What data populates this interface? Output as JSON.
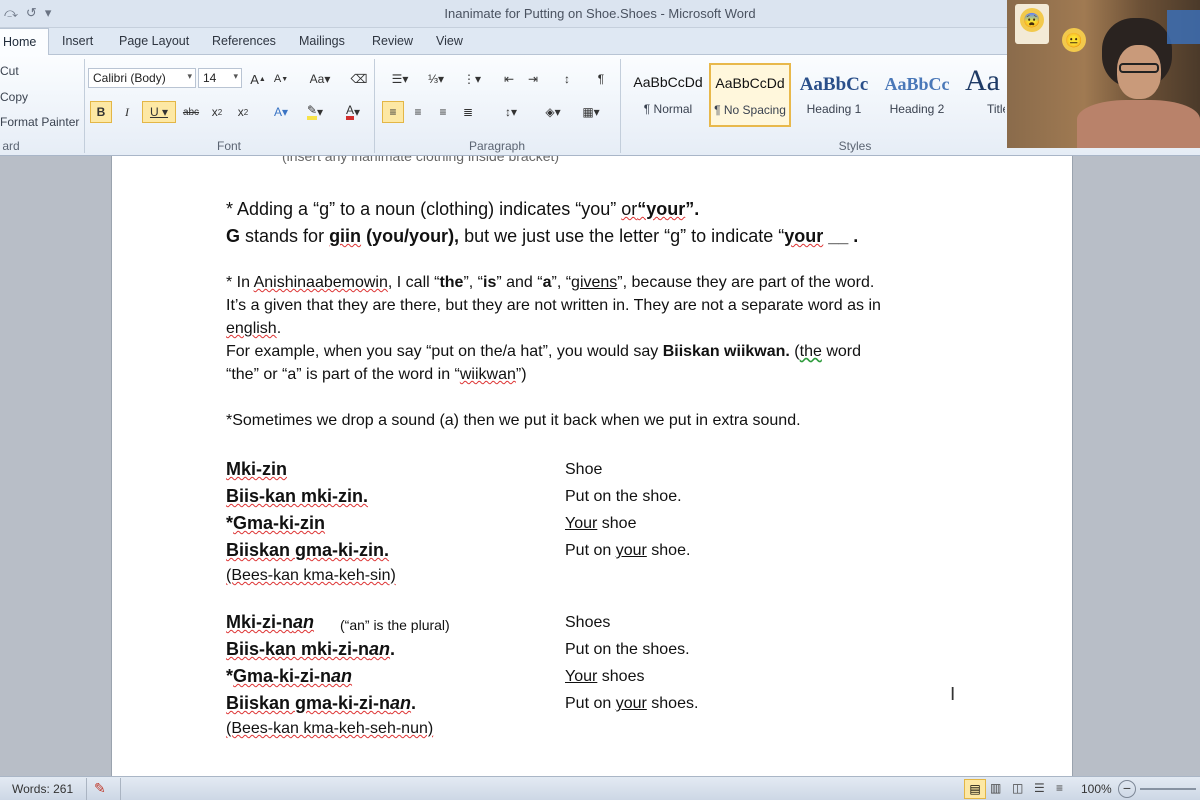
{
  "window": {
    "title": "Inanimate for Putting on Shoe.Shoes  -  Microsoft Word"
  },
  "tabs": [
    "Home",
    "Insert",
    "Page Layout",
    "References",
    "Mailings",
    "Review",
    "View"
  ],
  "clipboard": {
    "cut": "Cut",
    "copy": "Copy",
    "format_painter": "Format Painter",
    "group": "ard"
  },
  "font": {
    "name": "Calibri (Body)",
    "size": "14",
    "group": "Font"
  },
  "paragraph": {
    "group": "Paragraph"
  },
  "styles": {
    "group": "Styles",
    "items": [
      {
        "sample": "AaBbCcDd",
        "name": "¶ Normal"
      },
      {
        "sample": "AaBbCcDd",
        "name": "¶ No Spacing"
      },
      {
        "sample": "AaBbCc",
        "name": "Heading 1"
      },
      {
        "sample": "AaBbCc",
        "name": "Heading 2"
      },
      {
        "sample": "Aa",
        "name": "Title"
      }
    ]
  },
  "doc": {
    "top_cut": "(insert any inanimate clothing inside bracket)",
    "rule1a_pre": "* Adding a “g” to a noun (clothing) indicates “you” ",
    "rule1a_or": "or",
    "rule1a_your": "“your",
    "rule1a_end": "”.",
    "rule1b_g": "G",
    "rule1b_mid": " stands for ",
    "rule1b_giin": "giin",
    "rule1b_paren": " (you/your),",
    "rule1b_rest": "  but we just use the letter “g” to indicate “",
    "rule1b_your": "your",
    "rule1b_end": " __ .",
    "p2_l1_a": "* In ",
    "p2_l1_anish": "Anishinaabemowin",
    "p2_l1_b": ", I call “",
    "p2_l1_the": "the",
    "p2_l1_c": "”, “",
    "p2_l1_is": "is",
    "p2_l1_d": "” and “",
    "p2_l1_a2": "a",
    "p2_l1_e": "”, “",
    "p2_l1_givens": "givens",
    "p2_l1_f": "”, because they are part of the word.",
    "p2_l2": "It’s a given that they are there, but they are not written in.  They are not a separate word as in",
    "p2_l3": "english",
    "p2_l3_end": ".",
    "p2_l4_a": "For example, when you say “put on the/a hat”, you would say ",
    "p2_l4_b": "Biiskan wiikwan.",
    "p2_l4_c": "  (",
    "p2_l4_the": "the",
    "p2_l4_d": " word",
    "p2_l5_a": "“the” or “a” is part of the word in “",
    "p2_l5_w": "wiikwan",
    "p2_l5_b": "”)",
    "p3": "*Sometimes we drop a sound (a) then we put it back when we put in extra sound.",
    "s1_w1": "Mki-zin",
    "s1_e1": "Shoe",
    "s1_w2": "Biis-kan mki-zin.",
    "s1_e2": "Put on the shoe.",
    "s1_w3_star": "*",
    "s1_w3": "Gma-ki-zin",
    "s1_e3_u": "Your",
    "s1_e3_rest": " shoe",
    "s1_w4": "Biiskan gma-ki-zin.",
    "s1_e4_a": "Put on ",
    "s1_e4_u": "your",
    "s1_e4_b": " shoe.",
    "s1_pron": "(Bees-kan kma-keh-sin)",
    "s2_w1_a": "Mki-zi-n",
    "s2_w1_b": "an",
    "s2_note": "(“an” is the plural)",
    "s2_e1": "Shoes",
    "s2_w2_a": "Biis-kan mki-zi-n",
    "s2_w2_b": "an",
    "s2_w2_c": ".",
    "s2_e2": "Put on the shoes.",
    "s2_w3_star": "*",
    "s2_w3_a": "Gma-ki-zi-n",
    "s2_w3_b": "an",
    "s2_e3_u": "Your",
    "s2_e3_rest": " shoes",
    "s2_w4_a": "Biiskan gma-ki-zi-n",
    "s2_w4_b": "an",
    "s2_w4_c": ".",
    "s2_e4_a": "Put on ",
    "s2_e4_u": "your",
    "s2_e4_b": " shoes.",
    "s2_pron": "(Bees-kan kma-keh-seh-nun)"
  },
  "status": {
    "words": "Words: 261",
    "zoom": "100%"
  },
  "colors": {
    "accent": "#2b579a",
    "selected": "#fde8a4",
    "squiggle": "#d33333",
    "highlight": "#f7e34a",
    "fontcolor": "#d12d2d"
  },
  "icons": [
    "undo-icon",
    "save-icon",
    "bold-icon",
    "italic-icon",
    "underline-icon",
    "zoom-out-icon",
    "cursor-ibeam-icon"
  ]
}
